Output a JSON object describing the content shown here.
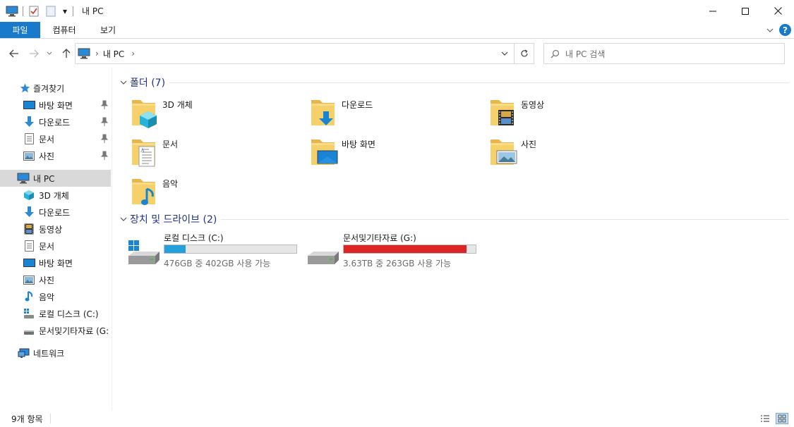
{
  "window": {
    "title": "내 PC",
    "quick_access_dropdown": "▾"
  },
  "ribbon": {
    "tabs": [
      {
        "label": "파일"
      },
      {
        "label": "컴퓨터"
      },
      {
        "label": "보기"
      }
    ],
    "help_label": "?"
  },
  "address": {
    "crumb": "내 PC",
    "separator": "›"
  },
  "search": {
    "placeholder": "내 PC 검색"
  },
  "sidebar": {
    "quick_access": "즐겨찾기",
    "quick_items": [
      {
        "label": "바탕 화면",
        "icon": "desktop-icon"
      },
      {
        "label": "다운로드",
        "icon": "download-arrow-icon"
      },
      {
        "label": "문서",
        "icon": "document-icon"
      },
      {
        "label": "사진",
        "icon": "picture-icon"
      }
    ],
    "this_pc": "내 PC",
    "pc_items": [
      {
        "label": "3D 개체",
        "icon": "cube-3d-icon"
      },
      {
        "label": "다운로드",
        "icon": "download-arrow-icon"
      },
      {
        "label": "동영상",
        "icon": "film-icon"
      },
      {
        "label": "문서",
        "icon": "document-icon"
      },
      {
        "label": "바탕 화면",
        "icon": "desktop-icon"
      },
      {
        "label": "사진",
        "icon": "picture-icon"
      },
      {
        "label": "음악",
        "icon": "music-note-icon"
      },
      {
        "label": "로컬 디스크 (C:)",
        "icon": "windows-drive-icon"
      },
      {
        "label": "문서및기타자료 (G:",
        "icon": "drive-icon"
      }
    ],
    "network": "네트워크"
  },
  "content": {
    "folders_header": "폴더 (7)",
    "folders": [
      {
        "name": "3D 개체",
        "icon": "folder-3d-icon"
      },
      {
        "name": "다운로드",
        "icon": "folder-download-icon"
      },
      {
        "name": "동영상",
        "icon": "folder-video-icon"
      },
      {
        "name": "문서",
        "icon": "folder-document-icon"
      },
      {
        "name": "바탕 화면",
        "icon": "folder-desktop-icon"
      },
      {
        "name": "사진",
        "icon": "folder-pictures-icon"
      },
      {
        "name": "음악",
        "icon": "folder-music-icon"
      }
    ],
    "drives_header": "장치 및 드라이브 (2)",
    "drives": [
      {
        "name": "로컬 디스크 (C:)",
        "detail": "476GB 중 402GB 사용 가능",
        "used_fraction": 0.16,
        "color": "#26a0da"
      },
      {
        "name": "문서및기타자료 (G:)",
        "detail": "3.63TB 중 263GB 사용 가능",
        "used_fraction": 0.93,
        "color": "#da2626"
      }
    ]
  },
  "status": {
    "item_count": "9개 항목"
  },
  "colors": {
    "accent": "#1979ca",
    "group_header": "#1e3287",
    "selected_nav": "#d9d9d9",
    "folder_yellow": "#f4c24d"
  }
}
